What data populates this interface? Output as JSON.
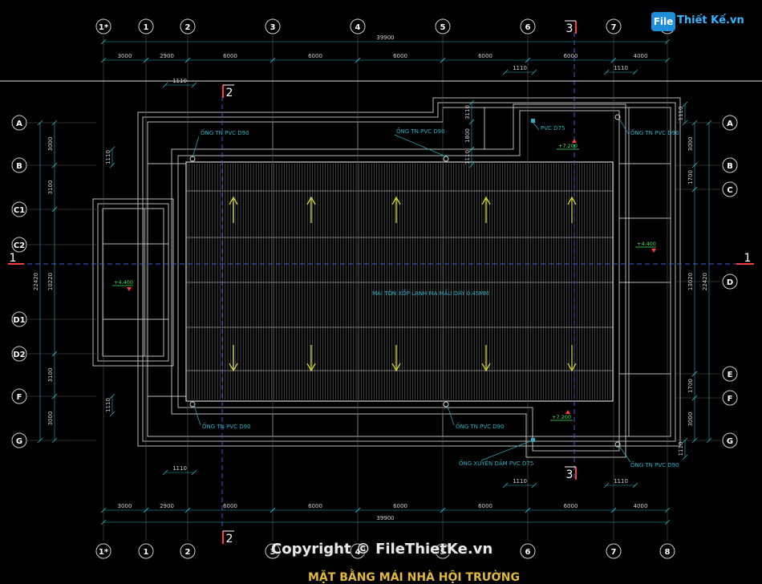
{
  "drawing": {
    "total_length_label": "39900",
    "spans": [
      "3000",
      "2900",
      "6000",
      "6000",
      "6000",
      "6000",
      "6000",
      "4000"
    ],
    "small_dim": "1110",
    "col_axes": [
      "1*",
      "1",
      "2",
      "3",
      "4",
      "5",
      "6",
      "7",
      "8"
    ],
    "left_row_axes": [
      "A",
      "B",
      "C1",
      "C2",
      "D1",
      "D2",
      "F",
      "G"
    ],
    "right_row_axes": [
      "A",
      "B",
      "C",
      "D",
      "E",
      "F",
      "G"
    ],
    "left_row_dims": [
      "3000",
      "3100",
      "10220",
      "3100",
      "3000"
    ],
    "right_row_dims": [
      "3000",
      "1700",
      "13020",
      "1700",
      "3000"
    ],
    "overall_width_label": "22420",
    "left_inner_dims": [
      "1110",
      "1110"
    ],
    "top_mid_dims": [
      "3110",
      "1800",
      "1110"
    ],
    "section_marks": {
      "s1": "1",
      "s2": "2",
      "s3": "3"
    },
    "roof_label": "MÁI TÔN XỐP LẠNH MẠ MẦU DÀY 0.45MM",
    "pipe_labels": {
      "pvc90_tl": "ỐNG TN PVC D90",
      "pvc90_tm": "ỐNG TN PVC D90",
      "pvc75_t": "PVC D75",
      "pvc90_tr": "ỐNG TN PVC D90",
      "pvc90_bl": "ỐNG TN PVC D90",
      "pvc90_bm": "ỐNG TN PVC D90",
      "pvc75_b": "ỐNG XUYÊN DẦM PVC D75",
      "pvc90_br": "ỐNG TN PVC D90"
    },
    "levels": {
      "top_right": "+7.200",
      "bottom_right": "+7.200",
      "left": "+4.400",
      "right": "+4.400"
    },
    "title": "MẶT BẰNG MÁI NHÀ HỘI TRƯỜNG"
  },
  "watermark": {
    "logo_box": "File",
    "logo_text": "Thiết Kế.vn",
    "copyright": "Copyright © FileThietKe.vn"
  },
  "colors": {
    "background": "#000000",
    "structure": "#b8b8b8",
    "axis": "#5a5a5a",
    "dimension": "#2ab0c2",
    "bubble_text": "#ffffff",
    "section": "#ff3b3b",
    "arrow": "#e6e63c",
    "level": "#42e65a",
    "axis_dash": "#3b5bd6",
    "logo": "#35b6ff"
  }
}
